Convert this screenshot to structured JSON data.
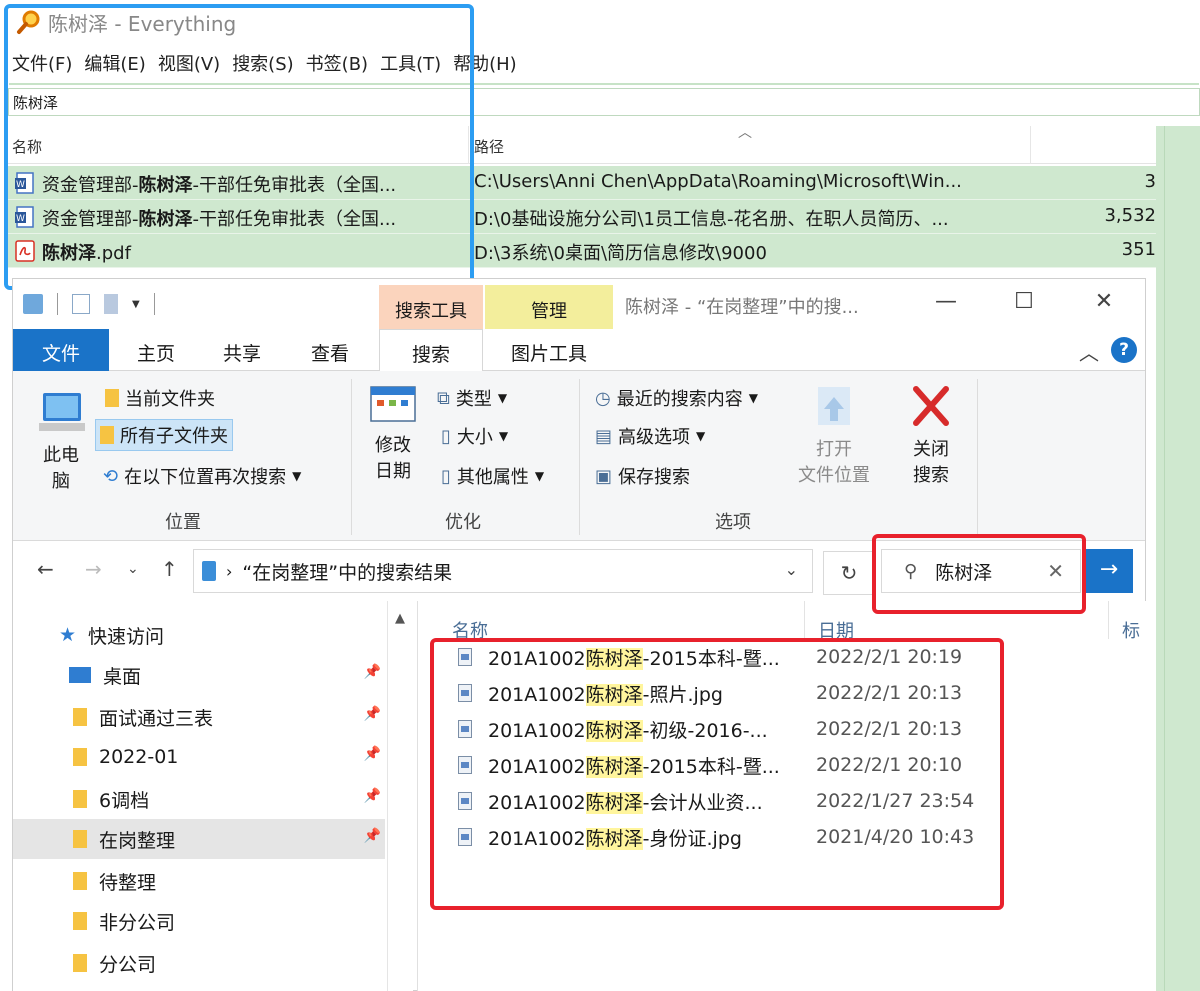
{
  "everything": {
    "title": "陈树泽 - Everything",
    "menu": [
      "文件(F)",
      "编辑(E)",
      "视图(V)",
      "搜索(S)",
      "书签(B)",
      "工具(T)",
      "帮助(H)"
    ],
    "search_value": "陈树泽",
    "columns": {
      "name": "名称",
      "path": "路径"
    },
    "rows": [
      {
        "pre": "资金管理部-",
        "hit": "陈树泽",
        "post": "-干部任免审批表（全国...",
        "path": "C:\\Users\\Anni Chen\\AppData\\Roaming\\Microsoft\\Win...",
        "size": "3",
        "icon": "word-doc-icon"
      },
      {
        "pre": "资金管理部-",
        "hit": "陈树泽",
        "post": "-干部任免审批表（全国...",
        "path": "D:\\0基础设施分公司\\1员工信息-花名册、在职人员简历、...",
        "size": "3,532",
        "icon": "word-doc-icon"
      },
      {
        "pre": "",
        "hit": "陈树泽",
        "post": ".pdf",
        "path": "D:\\3系统\\0桌面\\简历信息修改\\9000",
        "size": "351",
        "icon": "pdf-icon"
      }
    ]
  },
  "explorer": {
    "window_title": "陈树泽 - “在岗整理”中的搜...",
    "context_tabs": [
      "搜索工具",
      "管理"
    ],
    "tabs": [
      "文件",
      "主页",
      "共享",
      "查看",
      "搜索",
      "图片工具"
    ],
    "ribbon": {
      "location": {
        "label": "位置",
        "this_pc": "此电\n脑",
        "current_folder": "当前文件夹",
        "all_subfolders": "所有子文件夹",
        "search_again": "在以下位置再次搜索"
      },
      "refine": {
        "label": "优化",
        "date_modified": "修改\n日期",
        "type": "类型",
        "size": "大小",
        "other_props": "其他属性"
      },
      "options": {
        "label": "选项",
        "recent": "最近的搜索内容",
        "advanced": "高级选项",
        "save": "保存搜索",
        "open_location": "打开\n文件位置",
        "close_search": "关闭\n搜索"
      }
    },
    "address": "“在岗整理”中的搜索结果",
    "search_value": "陈树泽",
    "nav": [
      {
        "label": "快速访问",
        "icon": "star-icon",
        "pinned": false
      },
      {
        "label": "桌面",
        "icon": "desktop-icon",
        "pinned": true
      },
      {
        "label": "面试通过三表",
        "icon": "folder-icon",
        "pinned": true
      },
      {
        "label": "2022-01",
        "icon": "folder-icon",
        "pinned": true
      },
      {
        "label": "6调档",
        "icon": "folder-icon",
        "pinned": true
      },
      {
        "label": "在岗整理",
        "icon": "folder-icon",
        "pinned": true
      },
      {
        "label": "待整理",
        "icon": "folder-icon",
        "pinned": false
      },
      {
        "label": "非分公司",
        "icon": "folder-icon",
        "pinned": false
      },
      {
        "label": "分公司",
        "icon": "folder-icon",
        "pinned": false
      }
    ],
    "columns": {
      "name": "名称",
      "date": "日期",
      "tag": "标"
    },
    "files": [
      {
        "pre": "201A1002",
        "hit": "陈树泽",
        "post": "-2015本科-暨...",
        "date": "2022/2/1 20:19"
      },
      {
        "pre": "201A1002",
        "hit": "陈树泽",
        "post": "-照片.jpg",
        "date": "2022/2/1 20:13"
      },
      {
        "pre": "201A1002",
        "hit": "陈树泽",
        "post": "-初级-2016-...",
        "date": "2022/2/1 20:13"
      },
      {
        "pre": "201A1002",
        "hit": "陈树泽",
        "post": "-2015本科-暨...",
        "date": "2022/2/1 20:10"
      },
      {
        "pre": "201A1002",
        "hit": "陈树泽",
        "post": "-会计从业资...",
        "date": "2022/1/27 23:54"
      },
      {
        "pre": "201A1002",
        "hit": "陈树泽",
        "post": "-身份证.jpg",
        "date": "2021/4/20 10:43"
      }
    ]
  },
  "colors": {
    "blue_highlight": "#2c9df2",
    "red_highlight": "#e8212c",
    "everything_row_bg": "#cfe8cf",
    "explorer_accent": "#1a73c8",
    "match_highlight": "#fff59d"
  }
}
